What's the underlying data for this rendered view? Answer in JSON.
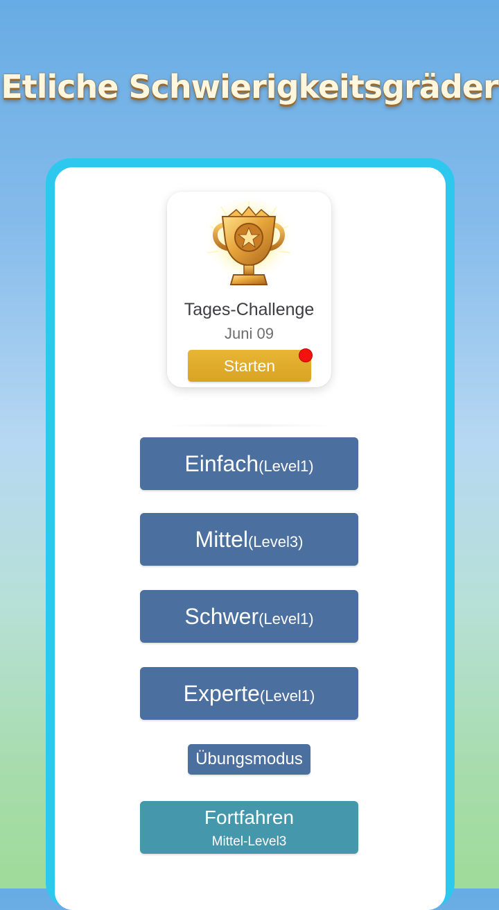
{
  "headline": "Etliche Schwierigkeitsgräder",
  "daily_challenge": {
    "title": "Tages-Challenge",
    "date": "Juni 09",
    "start_label": "Starten",
    "has_notification": true,
    "icon": "trophy-icon"
  },
  "difficulties": [
    {
      "name": "Einfach",
      "level": "(Level1)"
    },
    {
      "name": "Mittel",
      "level": "(Level3)"
    },
    {
      "name": "Schwer",
      "level": "(Level1)"
    },
    {
      "name": "Experte",
      "level": "(Level1)"
    }
  ],
  "practice_label": "Übungsmodus",
  "continue": {
    "label": "Fortfahren",
    "sublabel": "Mittel-Level3"
  },
  "colors": {
    "frame": "#2ec8ee",
    "level_button": "#4b6f9f",
    "continue_button": "#4597ab",
    "start_button": "#e0ac2b",
    "notification_dot": "#f2130f"
  }
}
